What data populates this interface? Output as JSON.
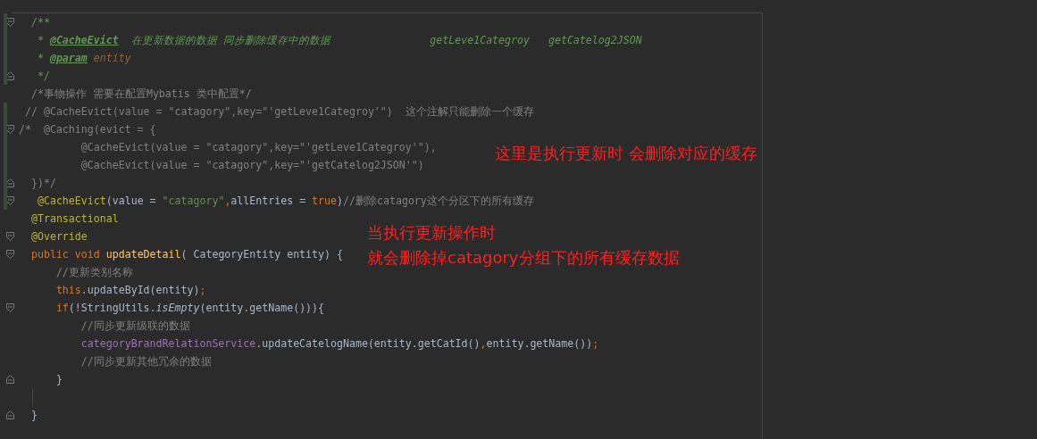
{
  "editor": {
    "lines": [
      {
        "changed": true,
        "fold_start": true,
        "fold_end": false,
        "tokens": [
          {
            "kind": "doc",
            "text": "  /**"
          }
        ]
      },
      {
        "changed": true,
        "fold_start": false,
        "fold_end": false,
        "tokens": [
          {
            "kind": "doc",
            "text": "   * "
          },
          {
            "kind": "doctag",
            "text": "@CacheEvict"
          },
          {
            "kind": "doc",
            "text": "  在更新数据的数据 同步删除缓存中的数据"
          },
          {
            "kind": "doc",
            "text": "                getLeve1Categroy   getCatelog2JSON"
          }
        ]
      },
      {
        "changed": true,
        "fold_start": false,
        "fold_end": false,
        "tokens": [
          {
            "kind": "doc",
            "text": "   * "
          },
          {
            "kind": "doctag",
            "text": "@param"
          },
          {
            "kind": "docvalue",
            "text": " entity"
          }
        ]
      },
      {
        "changed": true,
        "fold_start": false,
        "fold_end": true,
        "tokens": [
          {
            "kind": "doc",
            "text": "   */"
          }
        ]
      },
      {
        "changed": false,
        "fold_start": false,
        "fold_end": false,
        "tokens": [
          {
            "kind": "comment",
            "text": "  /*事物操作 需要在配置Mybatis 类中配置*/"
          }
        ]
      },
      {
        "changed": true,
        "fold_start": false,
        "fold_end": false,
        "tokens": [
          {
            "kind": "comment",
            "text": " // @CacheEvict(value = \"catagory\",key=\"'getLeve1Categroy'\")  这个注解只能删除一个缓存"
          }
        ]
      },
      {
        "changed": true,
        "fold_start": true,
        "fold_end": false,
        "tokens": [
          {
            "kind": "comment",
            "text": "/*  @Caching(evict = {"
          }
        ]
      },
      {
        "changed": true,
        "fold_start": false,
        "fold_end": false,
        "tokens": [
          {
            "kind": "comment",
            "text": "          @CacheEvict(value = \"catagory\",key=\"'getLeve1Categroy'\"),"
          }
        ]
      },
      {
        "changed": true,
        "fold_start": false,
        "fold_end": false,
        "tokens": [
          {
            "kind": "comment",
            "text": "          @CacheEvict(value = \"catagory\",key=\"'getCatelog2JSON'\")"
          }
        ]
      },
      {
        "changed": true,
        "fold_start": false,
        "fold_end": true,
        "tokens": [
          {
            "kind": "comment",
            "text": "  })*/"
          }
        ]
      },
      {
        "changed": true,
        "fold_start": true,
        "fold_end": false,
        "tokens": [
          {
            "kind": "annotation",
            "text": "   @CacheEvict"
          },
          {
            "kind": "plain",
            "text": "(value = "
          },
          {
            "kind": "string",
            "text": "\"catagory\""
          },
          {
            "kind": "keyword",
            "text": ","
          },
          {
            "kind": "plain",
            "text": "allEntries = "
          },
          {
            "kind": "keyword",
            "text": "true"
          },
          {
            "kind": "plain",
            "text": ")"
          },
          {
            "kind": "comment",
            "text": "//删除catagory这个分区下的所有缓存"
          }
        ]
      },
      {
        "changed": false,
        "fold_start": false,
        "fold_end": false,
        "tokens": [
          {
            "kind": "annotation",
            "text": "  @Transactional"
          }
        ]
      },
      {
        "changed": false,
        "fold_start": true,
        "fold_end": false,
        "tokens": [
          {
            "kind": "annotation",
            "text": "  @Override"
          }
        ]
      },
      {
        "changed": false,
        "fold_start": true,
        "fold_end": false,
        "tokens": [
          {
            "kind": "keyword",
            "text": "  public void "
          },
          {
            "kind": "method",
            "text": "updateDetail"
          },
          {
            "kind": "plain",
            "text": "( CategoryEntity entity) {"
          }
        ]
      },
      {
        "changed": false,
        "fold_start": false,
        "fold_end": false,
        "tokens": [
          {
            "kind": "comment",
            "text": "      //更新类别名称"
          }
        ]
      },
      {
        "changed": false,
        "fold_start": false,
        "fold_end": false,
        "tokens": [
          {
            "kind": "keyword",
            "text": "      this"
          },
          {
            "kind": "plain",
            "text": ".updateById(entity)"
          },
          {
            "kind": "keyword",
            "text": ";"
          }
        ]
      },
      {
        "changed": false,
        "fold_start": true,
        "fold_end": false,
        "tokens": [
          {
            "kind": "keyword",
            "text": "      if"
          },
          {
            "kind": "plain",
            "text": "(!StringUtils."
          },
          {
            "kind": "italic",
            "text": "isEmpty"
          },
          {
            "kind": "plain",
            "text": "(entity.getName())){"
          }
        ]
      },
      {
        "changed": false,
        "fold_start": false,
        "fold_end": false,
        "tokens": [
          {
            "kind": "comment",
            "text": "          //同步更新级联的数据"
          }
        ]
      },
      {
        "changed": false,
        "fold_start": false,
        "fold_end": false,
        "tokens": [
          {
            "kind": "field",
            "text": "          categoryBrandRelationService"
          },
          {
            "kind": "plain",
            "text": ".updateCatelogName(entity.getCatId()"
          },
          {
            "kind": "keyword",
            "text": ","
          },
          {
            "kind": "plain",
            "text": "entity.getName())"
          },
          {
            "kind": "keyword",
            "text": ";"
          }
        ]
      },
      {
        "changed": false,
        "fold_start": false,
        "fold_end": false,
        "tokens": [
          {
            "kind": "comment",
            "text": "          //同步更新其他冗余的数据"
          }
        ]
      },
      {
        "changed": false,
        "fold_start": false,
        "fold_end": true,
        "tokens": [
          {
            "kind": "plain",
            "text": "      }"
          }
        ]
      },
      {
        "changed": false,
        "fold_start": false,
        "fold_end": false
      },
      {
        "changed": false,
        "fold_start": false,
        "fold_end": true,
        "tokens": [
          {
            "kind": "plain",
            "text": "  }"
          }
        ]
      }
    ]
  },
  "annotations": [
    {
      "text": "这里是执行更新时 会删除对应的缓存"
    },
    {
      "text": "当执行更新操作时"
    },
    {
      "text": "就会删除掉catagory分组下的所有缓存数据"
    }
  ]
}
